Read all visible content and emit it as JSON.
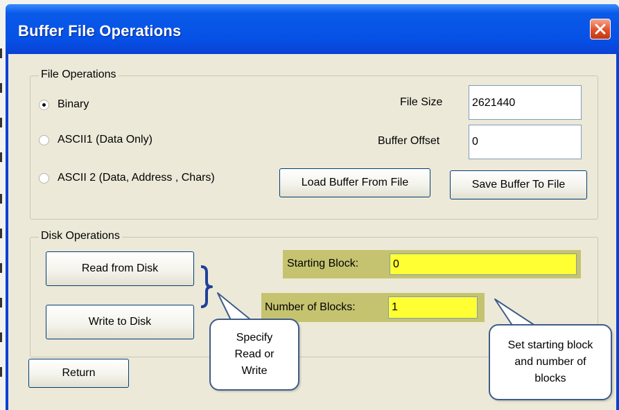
{
  "window": {
    "title": "Buffer File Operations"
  },
  "file_operations": {
    "group_label": "File Operations",
    "radios": [
      {
        "label": "Binary",
        "selected": true
      },
      {
        "label": "ASCII1 (Data Only)",
        "selected": false
      },
      {
        "label": "ASCII 2 (Data, Address , Chars)",
        "selected": false
      }
    ],
    "file_size_label": "File Size",
    "file_size_value": "2621440",
    "buffer_offset_label": "Buffer Offset",
    "buffer_offset_value": "0",
    "load_button": "Load Buffer From File",
    "save_button": "Save Buffer To File"
  },
  "disk_operations": {
    "group_label": "Disk Operations",
    "read_button": "Read from Disk",
    "write_button": "Write to Disk",
    "starting_block_label": "Starting Block:",
    "starting_block_value": "0",
    "number_of_blocks_label": "Number of Blocks:",
    "number_of_blocks_value": "1",
    "highlight_color": "#ffff33"
  },
  "return_button": "Return",
  "callouts": {
    "read_write": "Specify\nRead or\nWrite",
    "blocks": "Set starting block\nand number of\nblocks"
  },
  "icons": {
    "close": "close-icon",
    "brace": "curly-brace-icon"
  },
  "colors": {
    "title_bar": "#0a5ae8",
    "close_button": "#e0502b",
    "client_bg": "#ece9d8",
    "field_highlight": "#ffff33",
    "label_highlight": "#c6c370",
    "brace": "#1f3f9a"
  }
}
